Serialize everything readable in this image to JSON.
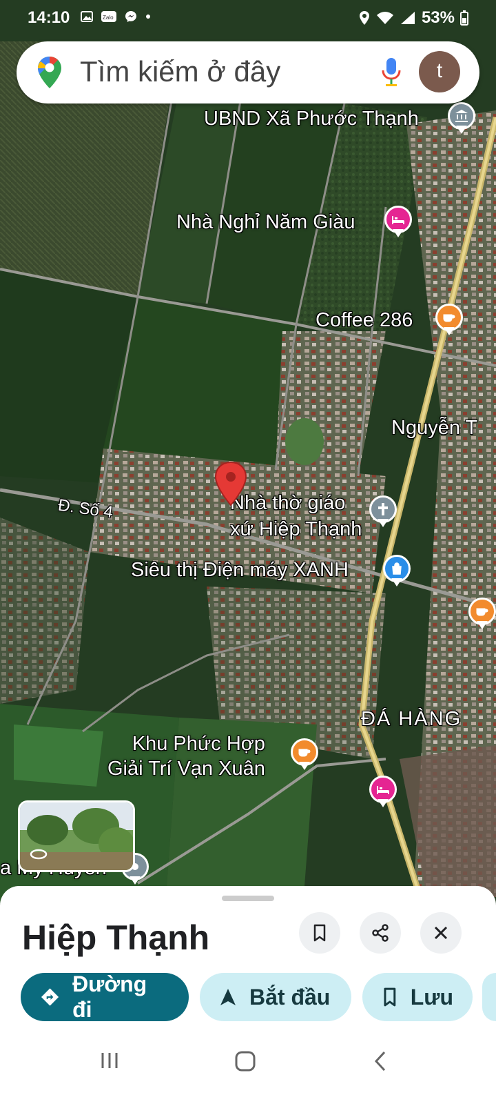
{
  "status_bar": {
    "time": "14:10",
    "notification_icons": [
      "gallery-icon",
      "zalo-icon",
      "messenger-icon",
      "dot-icon"
    ],
    "status_icons": [
      "location-icon",
      "wifi-icon",
      "signal-icon"
    ],
    "battery": "53%"
  },
  "search": {
    "placeholder": "Tìm kiếm ở đây",
    "avatar_letter": "t"
  },
  "map": {
    "labels": {
      "ubnd": "UBND Xã Phước Thạnh",
      "nha_nghi": "Nhà Nghỉ Năm Giàu",
      "coffee": "Coffee 286",
      "nguyen": "Nguyễn T",
      "road_so4": "Đ. Số 4",
      "church": "Nhà thờ giáo\nxứ Hiệp Thạnh",
      "dien_may": "Siêu thị Điện máy XANH",
      "da_hang": "ĐÁ HÀNG",
      "khu_phuc_hop": "Khu Phức Hợp\nGiải Trí Vạn Xuân",
      "my_huyen": "a My Huyền"
    }
  },
  "place_sheet": {
    "title": "Hiệp Thạnh",
    "actions": {
      "directions": "Đường đi",
      "start": "Bắt đầu",
      "save": "Lưu"
    }
  },
  "colors": {
    "primary_chip": "#0b6b7e",
    "secondary_chip": "#cdeef4",
    "marker_red": "#e53935",
    "lodging_pink": "#e52592",
    "food_orange": "#f28b2d",
    "government_gray": "#7d909b",
    "shopping_blue": "#2a8ee8"
  }
}
